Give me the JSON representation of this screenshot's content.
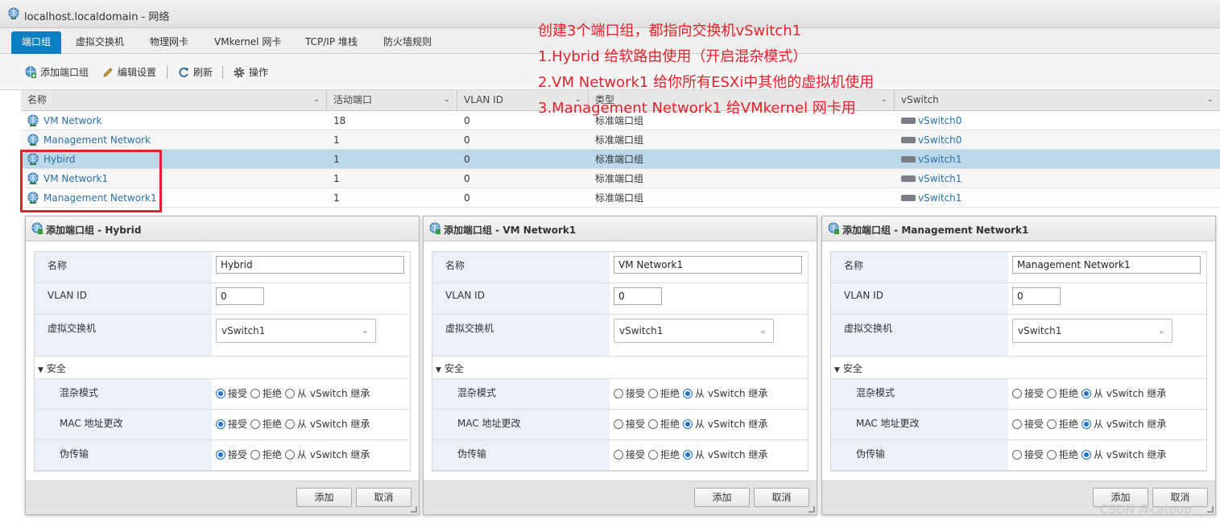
{
  "window": {
    "title": "localhost.localdomain - 网络"
  },
  "tabs": [
    "端口组",
    "虚拟交换机",
    "物理网卡",
    "VMkernel 网卡",
    "TCP/IP 堆栈",
    "防火墙规则"
  ],
  "toolbar": {
    "add_port_group": "添加端口组",
    "edit_settings": "编辑设置",
    "refresh": "刷新",
    "actions": "操作"
  },
  "table": {
    "columns": [
      "名称",
      "活动端口",
      "VLAN ID",
      "类型",
      "vSwitch"
    ],
    "rows": [
      {
        "name": "VM Network",
        "active_ports": "18",
        "vlan": "0",
        "type": "标准端口组",
        "vswitch": "vSwitch0"
      },
      {
        "name": "Management Network",
        "active_ports": "1",
        "vlan": "0",
        "type": "标准端口组",
        "vswitch": "vSwitch0"
      },
      {
        "name": "Hybird",
        "active_ports": "1",
        "vlan": "0",
        "type": "标准端口组",
        "vswitch": "vSwitch1"
      },
      {
        "name": "VM Network1",
        "active_ports": "1",
        "vlan": "0",
        "type": "标准端口组",
        "vswitch": "vSwitch1"
      },
      {
        "name": "Management Network1",
        "active_ports": "1",
        "vlan": "0",
        "type": "标准端口组",
        "vswitch": "vSwitch1"
      }
    ]
  },
  "annotation": {
    "line1": "创建3个端口组，都指向交换机vSwitch1",
    "line2": "1.Hybrid 给软路由使用（开启混杂模式）",
    "line3": "2.VM Network1 给你所有ESXi中其他的虚拟机使用",
    "line4": "3.Management Network1 给VMkernel 网卡用"
  },
  "form_labels": {
    "name": "名称",
    "vlan_id": "VLAN ID",
    "vswitch": "虚拟交换机",
    "security": "安全",
    "promiscuous": "混杂模式",
    "mac_change": "MAC 地址更改",
    "forged": "伪传输"
  },
  "radio_labels": {
    "accept": "接受",
    "reject": "拒绝",
    "inherit": "从 vSwitch 继承"
  },
  "dialogs": [
    {
      "title": "添加端口组 - Hybrid",
      "name_value": "Hybrid",
      "vlan_value": "0",
      "vswitch_value": "vSwitch1",
      "policy": "accept",
      "ok": "添加",
      "cancel": "取消"
    },
    {
      "title": "添加端口组 - VM Network1",
      "name_value": "VM Network1",
      "vlan_value": "0",
      "vswitch_value": "vSwitch1",
      "policy": "inherit",
      "ok": "添加",
      "cancel": "取消"
    },
    {
      "title": "添加端口组 - Management Network1",
      "name_value": "Management Network1",
      "vlan_value": "0",
      "vswitch_value": "vSwitch1",
      "policy": "inherit",
      "ok": "添加",
      "cancel": "取消"
    }
  ],
  "watermark": "CSDN @catoop",
  "colors": {
    "accent": "#0b7ec4",
    "annotation": "#e2222a",
    "selected_row": "#bcd9ea",
    "link": "#2a6fa8"
  }
}
